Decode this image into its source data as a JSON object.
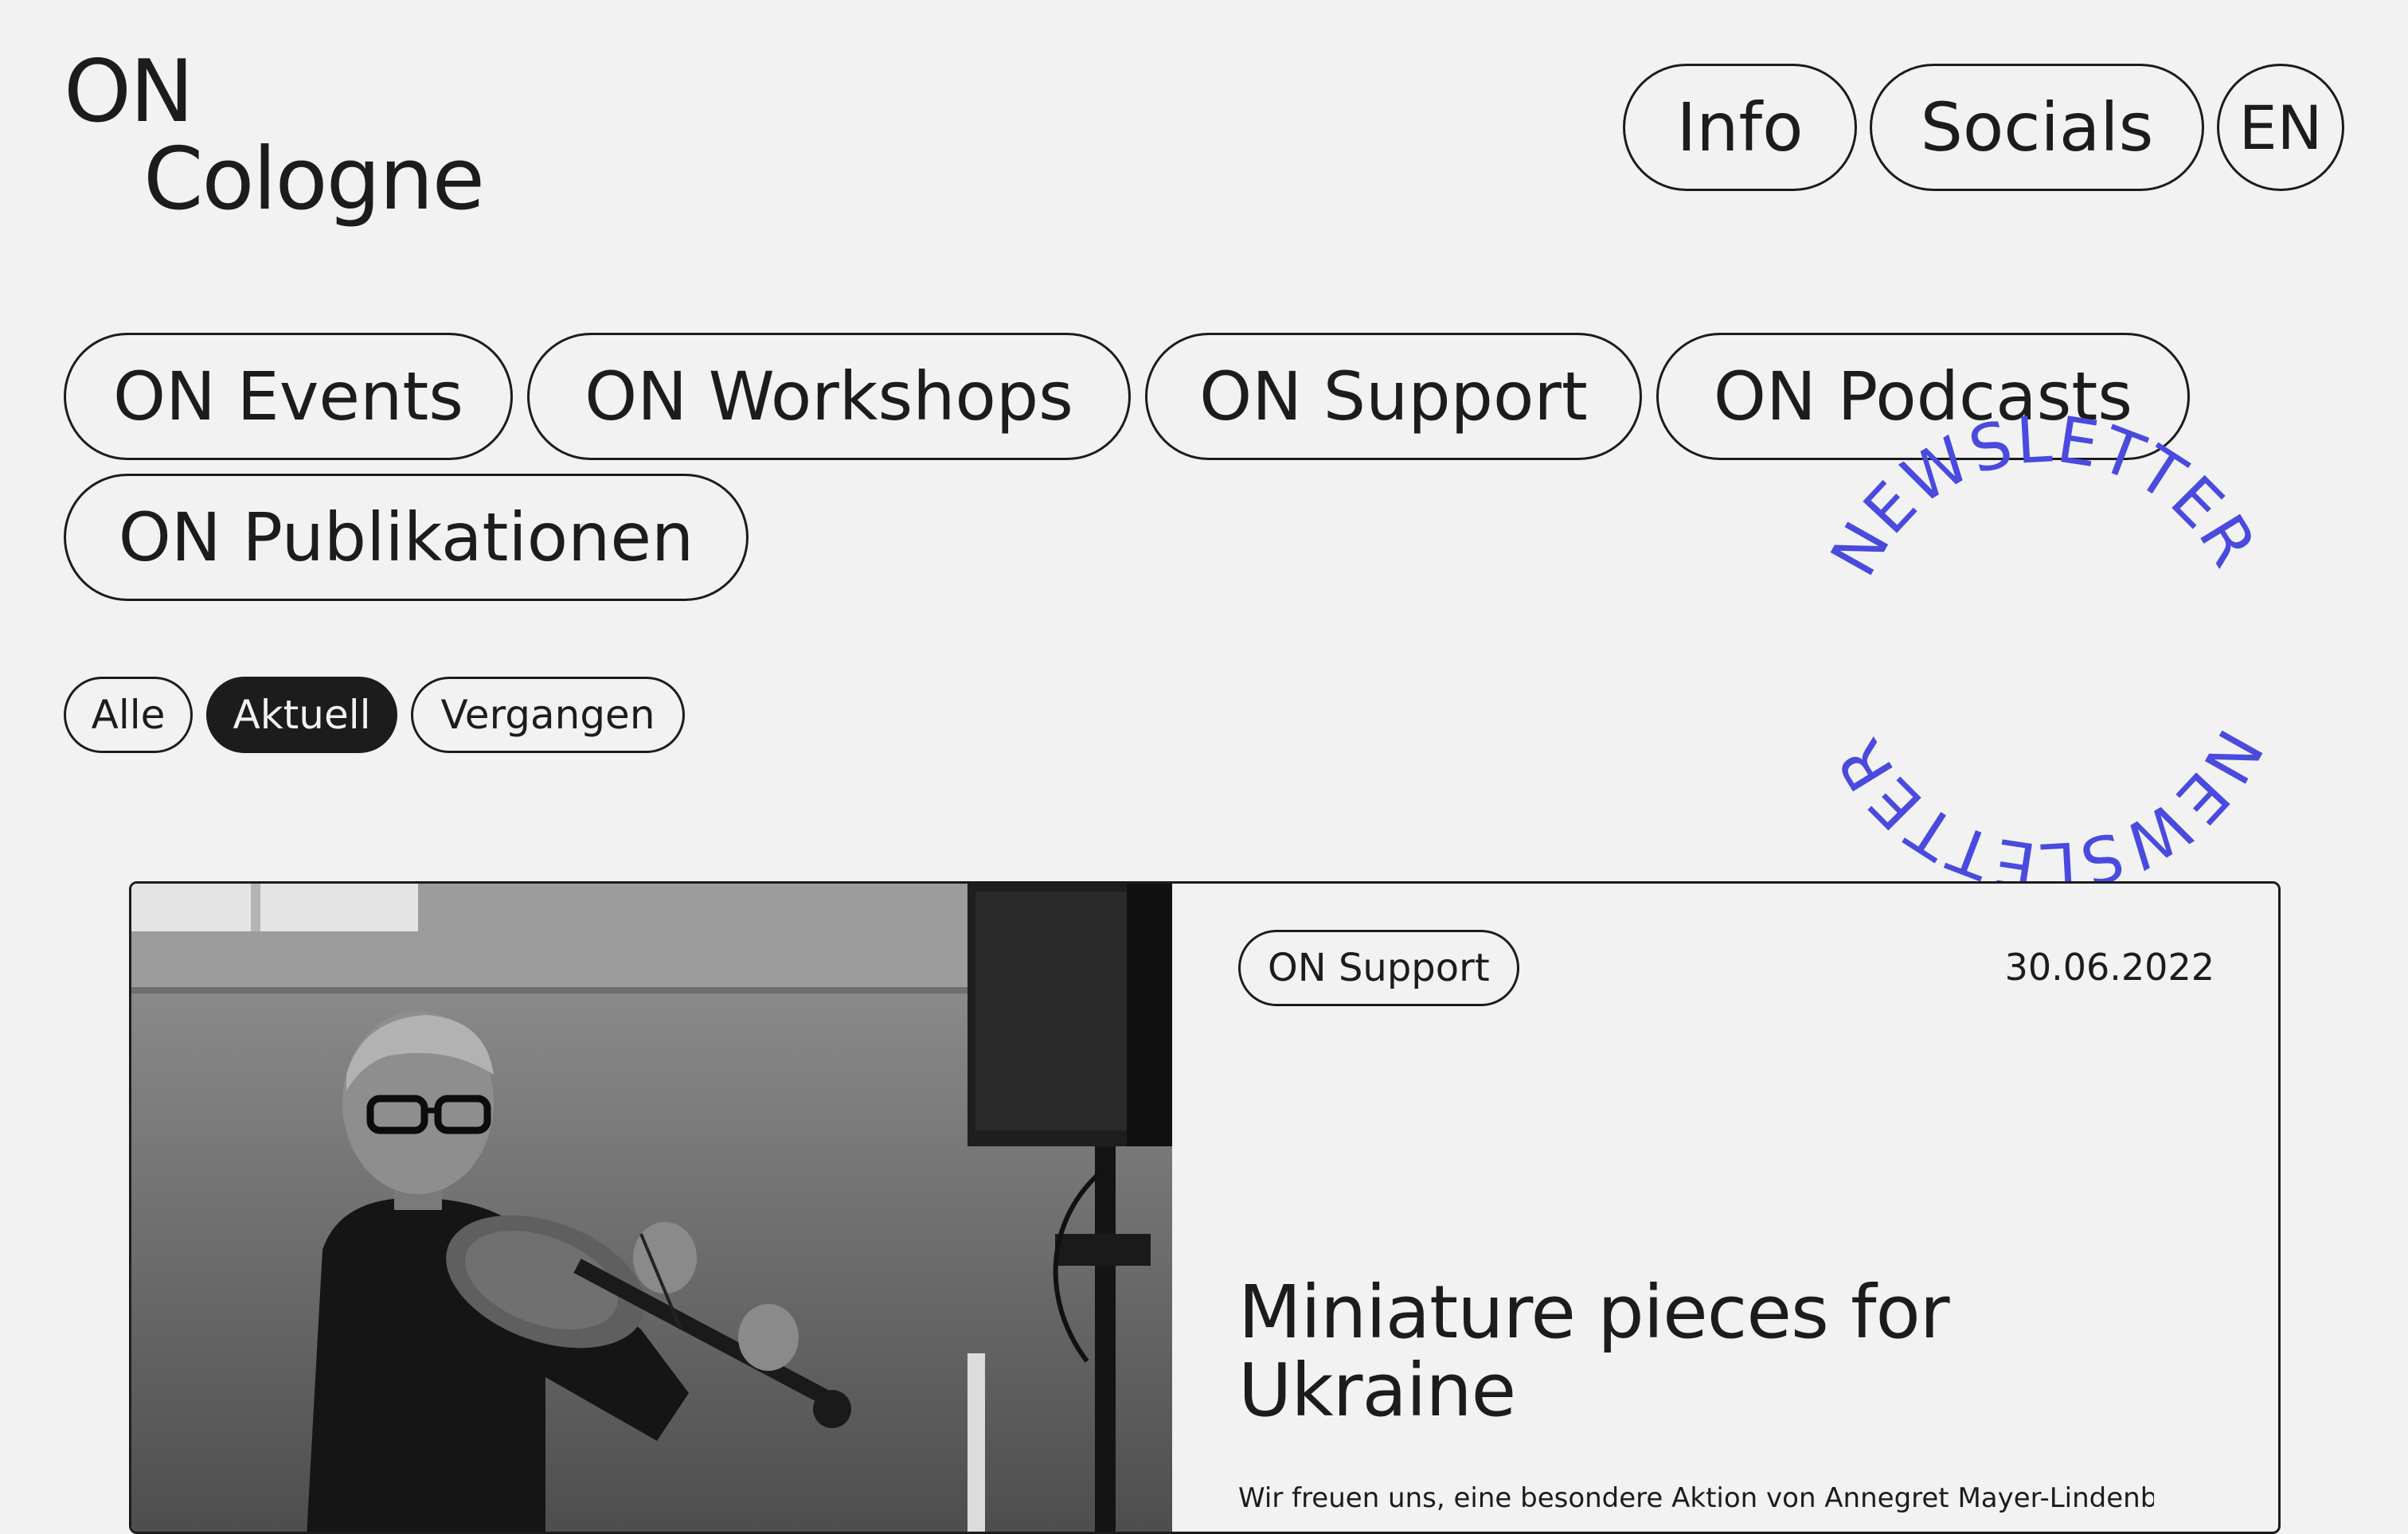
{
  "logo": {
    "line1": "ON",
    "line2": "Cologne"
  },
  "top_nav": {
    "info": "Info",
    "socials": "Socials",
    "language": "EN"
  },
  "categories": [
    "ON Events",
    "ON Workshops",
    "ON Support",
    "ON Podcasts",
    "ON Publikationen"
  ],
  "filters": {
    "all": "Alle",
    "current": "Aktuell",
    "past": "Vergangen",
    "active": "Aktuell"
  },
  "newsletter": {
    "label": "NEWSLETTER",
    "color": "#4a4adf"
  },
  "featured_post": {
    "tag": "ON Support",
    "date": "30.06.2022",
    "title": "Miniature pieces for Ukraine",
    "excerpt": "Wir freuen uns, eine besondere Aktion von Annegret Mayer-Lindenberg zu",
    "image": "black-and-white-photo-violinist"
  },
  "colors": {
    "background": "#f2f2f2",
    "text": "#1c1c1c",
    "accent": "#4a4adf"
  }
}
